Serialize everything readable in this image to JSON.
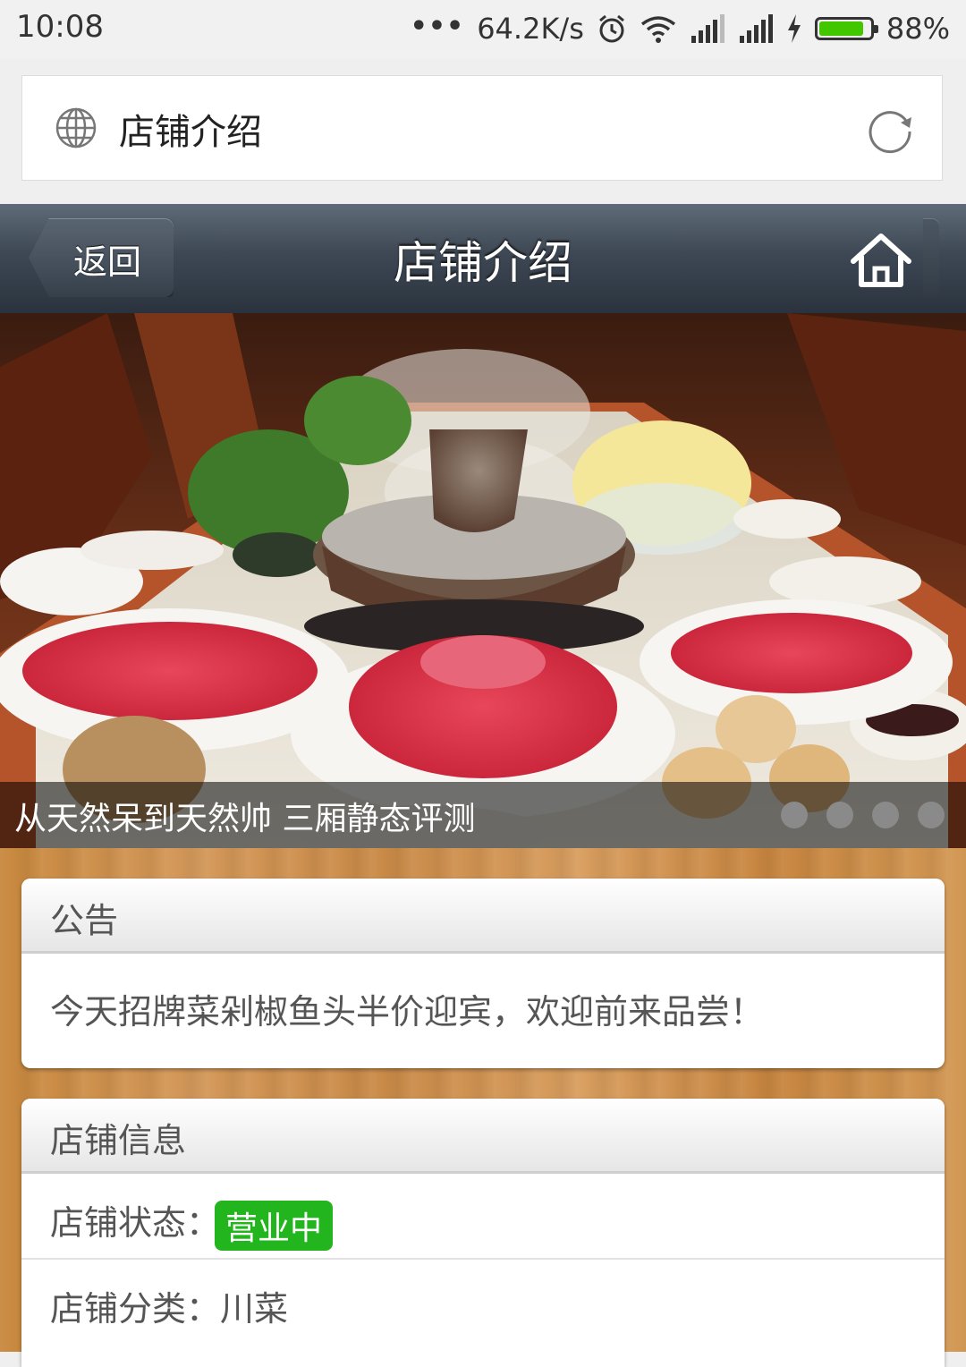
{
  "status_bar": {
    "time": "10:08",
    "dots": "•••",
    "speed": "64.2K/s",
    "battery_pct": "88%",
    "battery_level": 0.88,
    "colors": {
      "battery_fill": "#41c600"
    },
    "icons": [
      "alarm-icon",
      "wifi-icon",
      "signal-icon",
      "signal-icon",
      "charging-icon",
      "battery-icon"
    ]
  },
  "address_bar": {
    "title": "店铺介绍",
    "icons": [
      "globe-icon",
      "reload-icon"
    ]
  },
  "header": {
    "back_label": "返回",
    "title": "店铺介绍",
    "icons": [
      "home-icon"
    ]
  },
  "hero": {
    "caption": "从天然呆到天然帅 三厢静态评测",
    "slide_count": 4,
    "active_slide": 0
  },
  "notice": {
    "title": "公告",
    "text": "今天招牌菜剁椒鱼头半价迎宾，欢迎前来品尝！"
  },
  "shop_info": {
    "title": "店铺信息",
    "status_label": "店铺状态：",
    "status_value": "营业中",
    "status_color": "#22b51e",
    "category_label": "店铺分类：",
    "category_value": "川菜"
  }
}
